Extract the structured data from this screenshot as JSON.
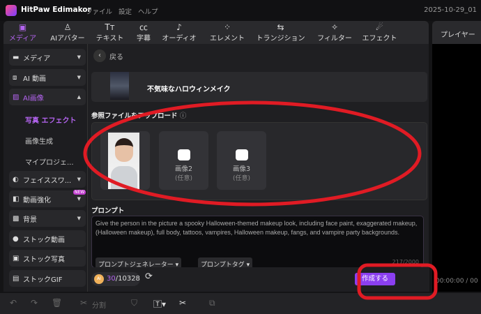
{
  "titlebar": {
    "app_name": "HitPaw Edimakor",
    "menus": [
      "ファイル",
      "設定",
      "ヘルプ"
    ],
    "project": "2025-10-29_01"
  },
  "tabs": [
    {
      "label": "メディア",
      "icon": "media-icon",
      "active": true
    },
    {
      "label": "AIアバター",
      "icon": "avatar-icon"
    },
    {
      "label": "テキスト",
      "icon": "text-icon"
    },
    {
      "label": "字幕",
      "icon": "subtitle-icon"
    },
    {
      "label": "オーディオ",
      "icon": "music-icon"
    },
    {
      "label": "エレメント",
      "icon": "element-icon"
    },
    {
      "label": "トランジション",
      "icon": "transition-icon"
    },
    {
      "label": "フィルター",
      "icon": "filter-icon"
    },
    {
      "label": "エフェクト",
      "icon": "effect-icon"
    }
  ],
  "player": {
    "title": "プレイヤー",
    "time": "00:00:00 / 00"
  },
  "sidebar": {
    "items": [
      {
        "label": "メディア"
      },
      {
        "label": "AI 動画"
      },
      {
        "label": "AI画像"
      },
      {
        "label": "フェイススワ..."
      },
      {
        "label": "動画強化",
        "badge": "NEW"
      },
      {
        "label": "背景"
      },
      {
        "label": "ストック動画"
      },
      {
        "label": "ストック写真"
      },
      {
        "label": "ストックGIF"
      }
    ],
    "sub": [
      "写真 エフェクト",
      "画像生成",
      "マイプロジェ..."
    ]
  },
  "main": {
    "back": "戻る",
    "template_title": "不気味なハロウィンメイク",
    "upload_label": "参照ファイルをアップロード",
    "slots": [
      {
        "label": "画像2",
        "optional": "(任意)"
      },
      {
        "label": "画像3",
        "optional": "(任意)"
      }
    ],
    "prompt_label": "プロンプト",
    "prompt": "Give the person in the picture a spooky Halloween-themed makeup look, including face paint, exaggerated makeup, (Halloween makeup), full body, tattoos, vampires, Halloween makeup, fangs, and vampire party backgrounds.",
    "prompt_generator": "プロンプトジェネレーター ▾",
    "prompt_tag": "プロンプトタグ ▾",
    "char_count": "217/2000",
    "credits_used": "30",
    "credits_total": "/10328",
    "create": "作成する"
  },
  "bottombar": {
    "split": "分割"
  },
  "colors": {
    "accent": "#b464f0",
    "button": "#8b3ff0",
    "annotation": "#e01b24"
  }
}
